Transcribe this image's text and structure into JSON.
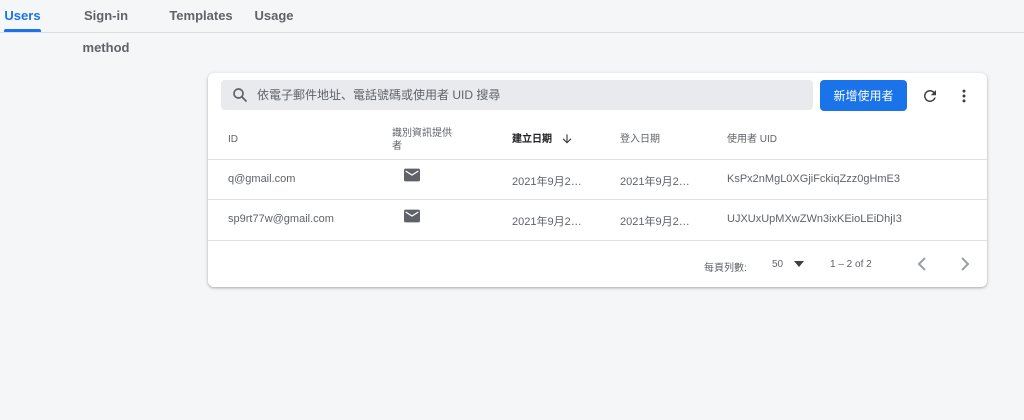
{
  "tabs": [
    {
      "label": "Users",
      "active": true
    },
    {
      "label": "Sign-in method",
      "active": false
    },
    {
      "label": "Templates",
      "active": false
    },
    {
      "label": "Usage",
      "active": false
    }
  ],
  "search": {
    "placeholder": "依電子郵件地址、電話號碼或使用者 UID 搜尋"
  },
  "add_user_label": "新增使用者",
  "table": {
    "headers": {
      "id": "ID",
      "provider_line1": "識別資訊提供",
      "provider_line2": "者",
      "created": "建立日期",
      "signed_in": "登入日期",
      "uid": "使用者 UID"
    },
    "rows": [
      {
        "id": "q@gmail.com",
        "provider_icon": "mail-icon",
        "created": "2021年9月2…",
        "signed_in": "2021年9月2…",
        "uid": "KsPx2nMgL0XGjiFckiqZzz0gHmE3"
      },
      {
        "id": "sp9rt77w@gmail.com",
        "provider_icon": "mail-icon",
        "created": "2021年9月2…",
        "signed_in": "2021年9月2…",
        "uid": "UJXUxUpMXwZWn3ixKEioLEiDhjI3"
      }
    ]
  },
  "footer": {
    "rows_per_page_label": "每頁列數:",
    "rows_per_page_value": "50",
    "range": "1 – 2 of 2"
  },
  "colors": {
    "accent": "#1a73e8",
    "background": "#f5f6f8"
  }
}
